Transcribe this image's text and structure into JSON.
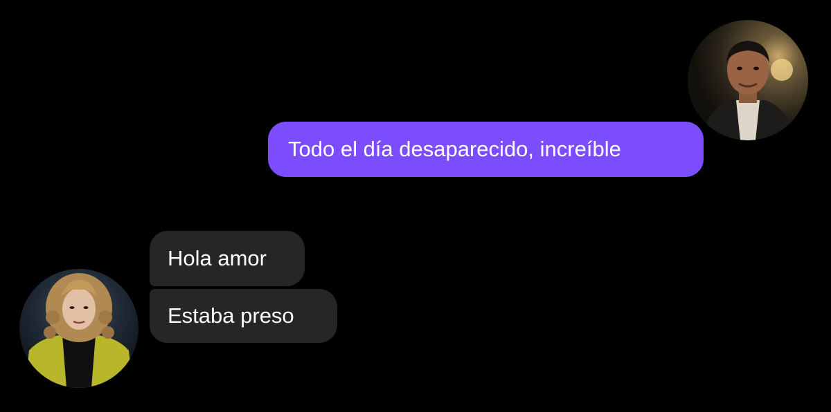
{
  "conversation": {
    "messages": [
      {
        "sender": "contact-right",
        "direction": "sent",
        "text": "Todo el día desaparecido, increíble"
      },
      {
        "sender": "contact-left",
        "direction": "received",
        "text": "Hola amor"
      },
      {
        "sender": "contact-left",
        "direction": "received",
        "text": "Estaba preso"
      }
    ]
  },
  "avatars": {
    "right": {
      "icon": "avatar-photo-dark-haired-man"
    },
    "left": {
      "icon": "avatar-photo-blond-curly-haired-man"
    }
  },
  "colors": {
    "background": "#000000",
    "sent_bubble": "#7c4dff",
    "received_bubble": "#262626",
    "text": "#ffffff"
  }
}
